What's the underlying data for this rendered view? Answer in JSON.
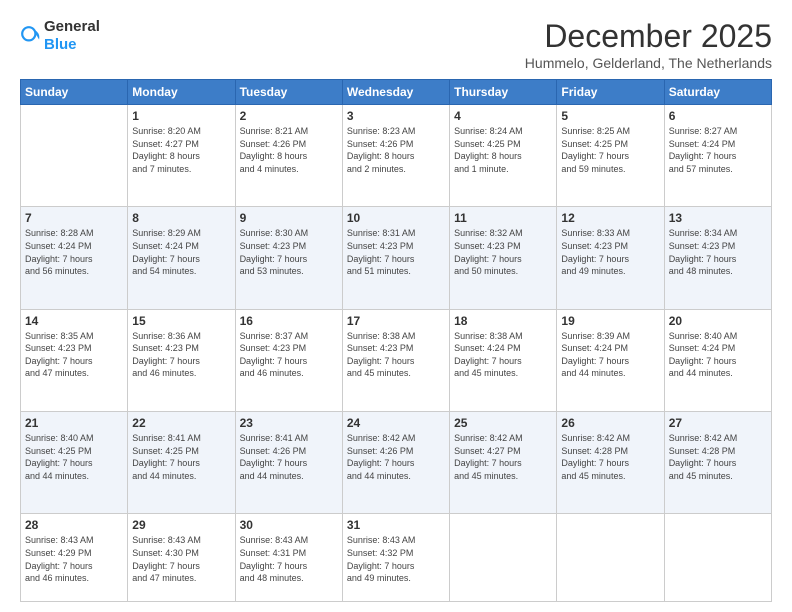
{
  "logo": {
    "general": "General",
    "blue": "Blue"
  },
  "title": "December 2025",
  "location": "Hummelo, Gelderland, The Netherlands",
  "days_of_week": [
    "Sunday",
    "Monday",
    "Tuesday",
    "Wednesday",
    "Thursday",
    "Friday",
    "Saturday"
  ],
  "weeks": [
    [
      {
        "day": "",
        "text": ""
      },
      {
        "day": "1",
        "text": "Sunrise: 8:20 AM\nSunset: 4:27 PM\nDaylight: 8 hours\nand 7 minutes."
      },
      {
        "day": "2",
        "text": "Sunrise: 8:21 AM\nSunset: 4:26 PM\nDaylight: 8 hours\nand 4 minutes."
      },
      {
        "day": "3",
        "text": "Sunrise: 8:23 AM\nSunset: 4:26 PM\nDaylight: 8 hours\nand 2 minutes."
      },
      {
        "day": "4",
        "text": "Sunrise: 8:24 AM\nSunset: 4:25 PM\nDaylight: 8 hours\nand 1 minute."
      },
      {
        "day": "5",
        "text": "Sunrise: 8:25 AM\nSunset: 4:25 PM\nDaylight: 7 hours\nand 59 minutes."
      },
      {
        "day": "6",
        "text": "Sunrise: 8:27 AM\nSunset: 4:24 PM\nDaylight: 7 hours\nand 57 minutes."
      }
    ],
    [
      {
        "day": "7",
        "text": "Sunrise: 8:28 AM\nSunset: 4:24 PM\nDaylight: 7 hours\nand 56 minutes."
      },
      {
        "day": "8",
        "text": "Sunrise: 8:29 AM\nSunset: 4:24 PM\nDaylight: 7 hours\nand 54 minutes."
      },
      {
        "day": "9",
        "text": "Sunrise: 8:30 AM\nSunset: 4:23 PM\nDaylight: 7 hours\nand 53 minutes."
      },
      {
        "day": "10",
        "text": "Sunrise: 8:31 AM\nSunset: 4:23 PM\nDaylight: 7 hours\nand 51 minutes."
      },
      {
        "day": "11",
        "text": "Sunrise: 8:32 AM\nSunset: 4:23 PM\nDaylight: 7 hours\nand 50 minutes."
      },
      {
        "day": "12",
        "text": "Sunrise: 8:33 AM\nSunset: 4:23 PM\nDaylight: 7 hours\nand 49 minutes."
      },
      {
        "day": "13",
        "text": "Sunrise: 8:34 AM\nSunset: 4:23 PM\nDaylight: 7 hours\nand 48 minutes."
      }
    ],
    [
      {
        "day": "14",
        "text": "Sunrise: 8:35 AM\nSunset: 4:23 PM\nDaylight: 7 hours\nand 47 minutes."
      },
      {
        "day": "15",
        "text": "Sunrise: 8:36 AM\nSunset: 4:23 PM\nDaylight: 7 hours\nand 46 minutes."
      },
      {
        "day": "16",
        "text": "Sunrise: 8:37 AM\nSunset: 4:23 PM\nDaylight: 7 hours\nand 46 minutes."
      },
      {
        "day": "17",
        "text": "Sunrise: 8:38 AM\nSunset: 4:23 PM\nDaylight: 7 hours\nand 45 minutes."
      },
      {
        "day": "18",
        "text": "Sunrise: 8:38 AM\nSunset: 4:24 PM\nDaylight: 7 hours\nand 45 minutes."
      },
      {
        "day": "19",
        "text": "Sunrise: 8:39 AM\nSunset: 4:24 PM\nDaylight: 7 hours\nand 44 minutes."
      },
      {
        "day": "20",
        "text": "Sunrise: 8:40 AM\nSunset: 4:24 PM\nDaylight: 7 hours\nand 44 minutes."
      }
    ],
    [
      {
        "day": "21",
        "text": "Sunrise: 8:40 AM\nSunset: 4:25 PM\nDaylight: 7 hours\nand 44 minutes."
      },
      {
        "day": "22",
        "text": "Sunrise: 8:41 AM\nSunset: 4:25 PM\nDaylight: 7 hours\nand 44 minutes."
      },
      {
        "day": "23",
        "text": "Sunrise: 8:41 AM\nSunset: 4:26 PM\nDaylight: 7 hours\nand 44 minutes."
      },
      {
        "day": "24",
        "text": "Sunrise: 8:42 AM\nSunset: 4:26 PM\nDaylight: 7 hours\nand 44 minutes."
      },
      {
        "day": "25",
        "text": "Sunrise: 8:42 AM\nSunset: 4:27 PM\nDaylight: 7 hours\nand 45 minutes."
      },
      {
        "day": "26",
        "text": "Sunrise: 8:42 AM\nSunset: 4:28 PM\nDaylight: 7 hours\nand 45 minutes."
      },
      {
        "day": "27",
        "text": "Sunrise: 8:42 AM\nSunset: 4:28 PM\nDaylight: 7 hours\nand 45 minutes."
      }
    ],
    [
      {
        "day": "28",
        "text": "Sunrise: 8:43 AM\nSunset: 4:29 PM\nDaylight: 7 hours\nand 46 minutes."
      },
      {
        "day": "29",
        "text": "Sunrise: 8:43 AM\nSunset: 4:30 PM\nDaylight: 7 hours\nand 47 minutes."
      },
      {
        "day": "30",
        "text": "Sunrise: 8:43 AM\nSunset: 4:31 PM\nDaylight: 7 hours\nand 48 minutes."
      },
      {
        "day": "31",
        "text": "Sunrise: 8:43 AM\nSunset: 4:32 PM\nDaylight: 7 hours\nand 49 minutes."
      },
      {
        "day": "",
        "text": ""
      },
      {
        "day": "",
        "text": ""
      },
      {
        "day": "",
        "text": ""
      }
    ]
  ]
}
